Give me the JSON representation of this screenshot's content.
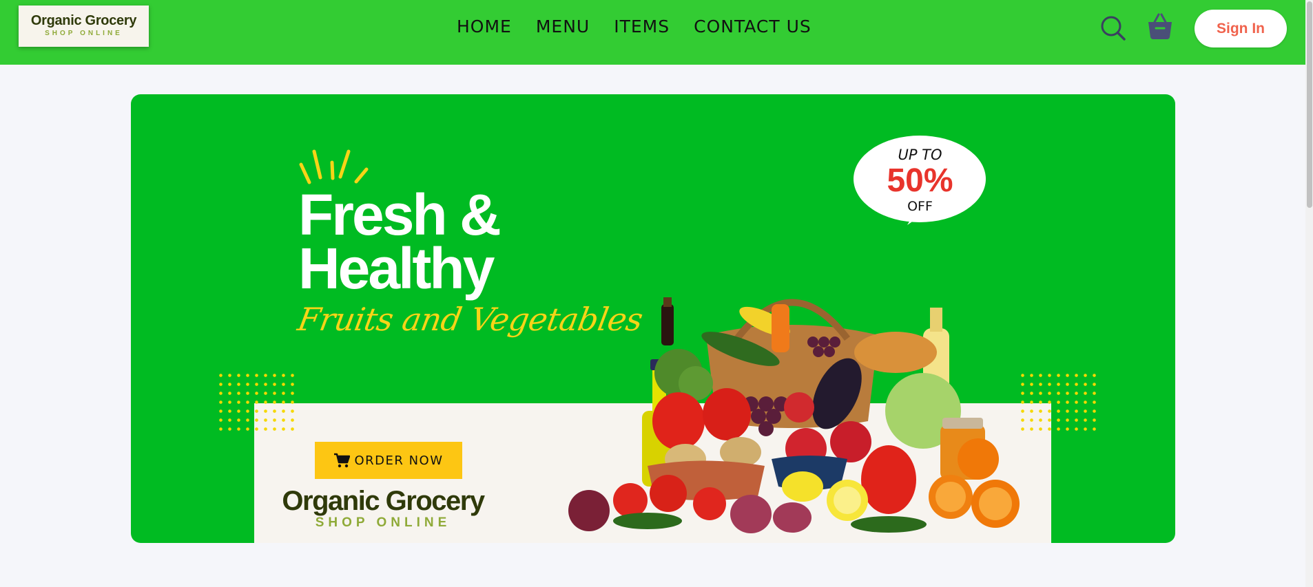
{
  "header": {
    "logo_title": "Organic Grocery",
    "logo_subtitle": "SHOP ONLINE",
    "nav": [
      "HOME",
      "MENU",
      "ITEMS",
      "CONTACT US"
    ],
    "search_icon": "search-icon",
    "cart_icon": "basket-icon",
    "sign_in": "Sign In"
  },
  "banner": {
    "headline": "Fresh &",
    "headline_2": "Healthy",
    "tagline": "Fruits and Vegetables",
    "promo_prefix": "UP TO",
    "promo_value": "50%",
    "promo_suffix": "OFF",
    "order_button": "ORDER NOW",
    "brand_title": "Organic Grocery",
    "brand_subtitle": "SHOP ONLINE"
  },
  "colors": {
    "header_bg": "#33cc33",
    "banner_bg": "#00bb22",
    "accent_yellow": "#fdc613",
    "promo_red": "#e8342c",
    "sign_in_text": "#f0624c",
    "brand_dark": "#2f3a0a",
    "brand_olive": "#8faa38"
  }
}
